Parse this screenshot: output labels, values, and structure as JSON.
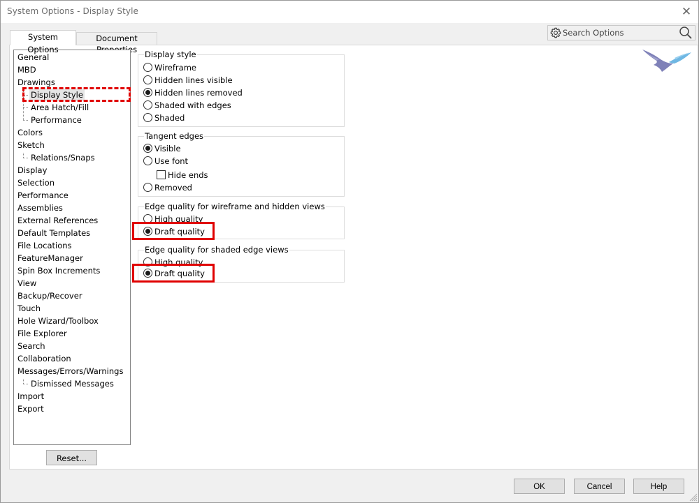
{
  "window": {
    "title": "System Options - Display Style",
    "close_icon": "close-icon"
  },
  "tabs": [
    {
      "label": "System Options",
      "active": true
    },
    {
      "label": "Document Properties",
      "active": false
    }
  ],
  "search": {
    "placeholder": "Search Options",
    "value": "",
    "left_icon": "gear-icon",
    "right_icon": "search-icon"
  },
  "tree": {
    "items": [
      {
        "label": "General",
        "level": 0
      },
      {
        "label": "MBD",
        "level": 0
      },
      {
        "label": "Drawings",
        "level": 0
      },
      {
        "label": "Display Style",
        "level": 1,
        "selected": true
      },
      {
        "label": "Area Hatch/Fill",
        "level": 1
      },
      {
        "label": "Performance",
        "level": 1
      },
      {
        "label": "Colors",
        "level": 0
      },
      {
        "label": "Sketch",
        "level": 0
      },
      {
        "label": "Relations/Snaps",
        "level": 1
      },
      {
        "label": "Display",
        "level": 0
      },
      {
        "label": "Selection",
        "level": 0
      },
      {
        "label": "Performance",
        "level": 0
      },
      {
        "label": "Assemblies",
        "level": 0
      },
      {
        "label": "External References",
        "level": 0
      },
      {
        "label": "Default Templates",
        "level": 0
      },
      {
        "label": "File Locations",
        "level": 0
      },
      {
        "label": "FeatureManager",
        "level": 0
      },
      {
        "label": "Spin Box Increments",
        "level": 0
      },
      {
        "label": "View",
        "level": 0
      },
      {
        "label": "Backup/Recover",
        "level": 0
      },
      {
        "label": "Touch",
        "level": 0
      },
      {
        "label": "Hole Wizard/Toolbox",
        "level": 0
      },
      {
        "label": "File Explorer",
        "level": 0
      },
      {
        "label": "Search",
        "level": 0
      },
      {
        "label": "Collaboration",
        "level": 0
      },
      {
        "label": "Messages/Errors/Warnings",
        "level": 0
      },
      {
        "label": "Dismissed Messages",
        "level": 1
      },
      {
        "label": "Import",
        "level": 0
      },
      {
        "label": "Export",
        "level": 0
      }
    ]
  },
  "reset_button": "Reset...",
  "groups": {
    "display_style": {
      "title": "Display style",
      "options": [
        {
          "label": "Wireframe",
          "checked": false
        },
        {
          "label": "Hidden lines visible",
          "checked": false
        },
        {
          "label": "Hidden lines removed",
          "checked": true
        },
        {
          "label": "Shaded with edges",
          "checked": false
        },
        {
          "label": "Shaded",
          "checked": false
        }
      ]
    },
    "tangent_edges": {
      "title": "Tangent edges",
      "options": [
        {
          "label": "Visible",
          "checked": true
        },
        {
          "label": "Use font",
          "checked": false
        },
        {
          "label": "Removed",
          "checked": false
        }
      ],
      "hide_ends": {
        "label": "Hide ends",
        "checked": false
      }
    },
    "edge_quality_wireframe": {
      "title": "Edge quality for wireframe and hidden views",
      "options": [
        {
          "label": "High quality",
          "checked": false
        },
        {
          "label": "Draft quality",
          "checked": true
        }
      ]
    },
    "edge_quality_shaded": {
      "title": "Edge quality for shaded edge views",
      "options": [
        {
          "label": "High quality",
          "checked": false
        },
        {
          "label": "Draft quality",
          "checked": true
        }
      ]
    }
  },
  "annotations": {
    "highlight_color": "#e00000"
  },
  "footer": {
    "ok": "OK",
    "cancel": "Cancel",
    "help": "Help"
  }
}
